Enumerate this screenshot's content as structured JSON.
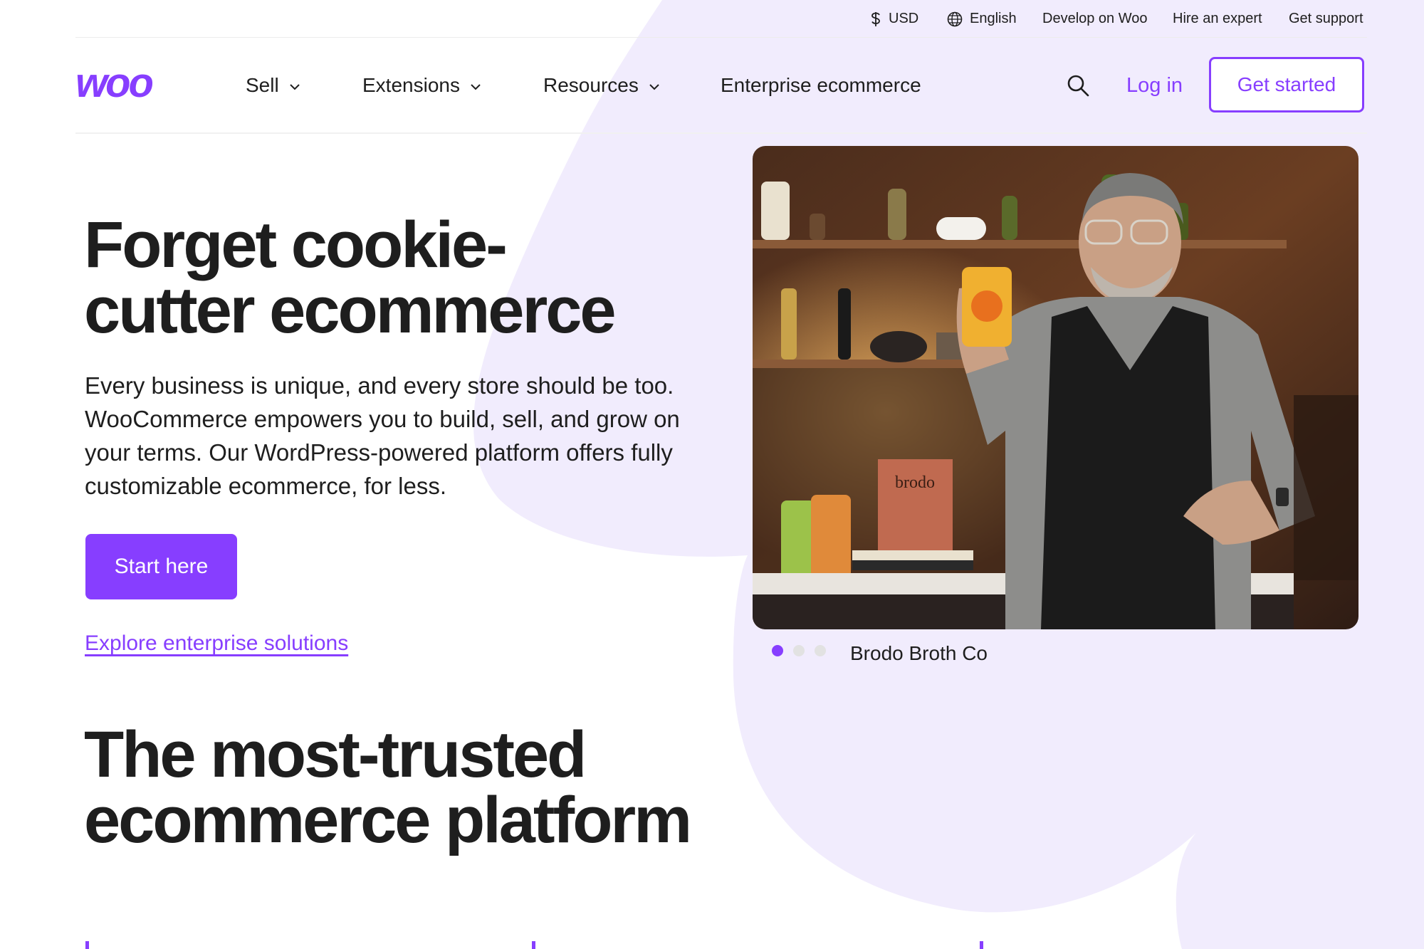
{
  "utility_bar": {
    "currency": "USD",
    "language": "English",
    "links": [
      "Develop on Woo",
      "Hire an expert",
      "Get support"
    ]
  },
  "nav": {
    "logo_text": "woo",
    "items": [
      {
        "label": "Sell",
        "has_dropdown": true
      },
      {
        "label": "Extensions",
        "has_dropdown": true
      },
      {
        "label": "Resources",
        "has_dropdown": true
      },
      {
        "label": "Enterprise ecommerce",
        "has_dropdown": false
      }
    ],
    "login": "Log in",
    "get_started": "Get started"
  },
  "hero": {
    "title_line1": "Forget cookie-",
    "title_line2": "cutter ecommerce",
    "body": "Every business is unique, and every store should be too. WooCommerce empowers you to build, sell, and grow on your terms. Our WordPress-powered platform offers fully customizable ecommerce, for less.",
    "cta": "Start here",
    "secondary_link": "Explore enterprise solutions"
  },
  "carousel": {
    "caption": "Brodo Broth Co",
    "slide_count": 3,
    "active_index": 0,
    "book_text": "brodo"
  },
  "trusted": {
    "title_line1": "The most-trusted",
    "title_line2": "ecommerce platform"
  },
  "colors": {
    "accent": "#873eff",
    "blob": "#f2eefc",
    "text": "#1e1e1e"
  }
}
